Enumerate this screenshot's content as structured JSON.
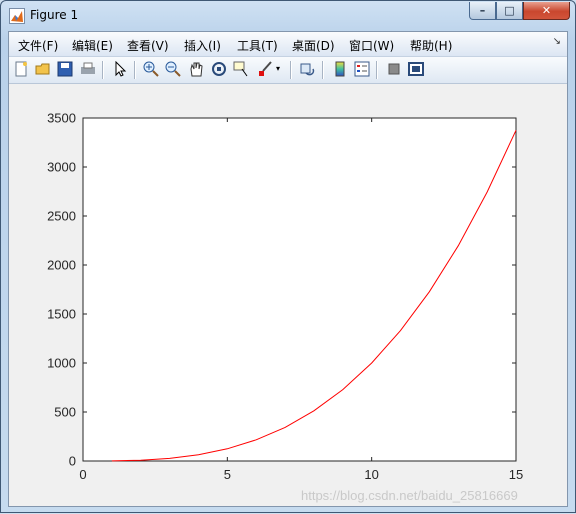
{
  "window": {
    "title": "Figure 1",
    "minimize_glyph": "–",
    "maximize_glyph": "□",
    "close_glyph": "✕"
  },
  "menu": {
    "items": [
      {
        "label": "文件(F)"
      },
      {
        "label": "编辑(E)"
      },
      {
        "label": "查看(V)"
      },
      {
        "label": "插入(I)"
      },
      {
        "label": "工具(T)"
      },
      {
        "label": "桌面(D)"
      },
      {
        "label": "窗口(W)"
      },
      {
        "label": "帮助(H)"
      }
    ],
    "overflow_glyph": "↘"
  },
  "toolbar": {
    "icons": [
      "new-figure-icon",
      "open-file-icon",
      "save-icon",
      "print-icon",
      "select-arrow-icon",
      "zoom-in-icon",
      "zoom-out-icon",
      "pan-hand-icon",
      "rotate-3d-icon",
      "data-cursor-icon",
      "brush-icon",
      "link-plot-icon",
      "colorbar-icon",
      "legend-icon",
      "hide-plot-tools-icon",
      "show-plot-tools-icon"
    ]
  },
  "chart_data": {
    "type": "line",
    "title": "",
    "xlabel": "",
    "ylabel": "",
    "xlim": [
      0,
      15
    ],
    "ylim": [
      0,
      3500
    ],
    "xticks": [
      0,
      5,
      10,
      15
    ],
    "yticks": [
      0,
      500,
      1000,
      1500,
      2000,
      2500,
      3000,
      3500
    ],
    "grid": false,
    "series": [
      {
        "color": "#ff0000",
        "x": [
          1,
          2,
          3,
          4,
          5,
          6,
          7,
          8,
          9,
          10,
          11,
          12,
          13,
          14,
          15
        ],
        "y": [
          1,
          8,
          27,
          64,
          125,
          216,
          343,
          512,
          729,
          1000,
          1331,
          1728,
          2197,
          2744,
          3375
        ]
      }
    ]
  },
  "watermark": "https://blog.csdn.net/baidu_25816669"
}
